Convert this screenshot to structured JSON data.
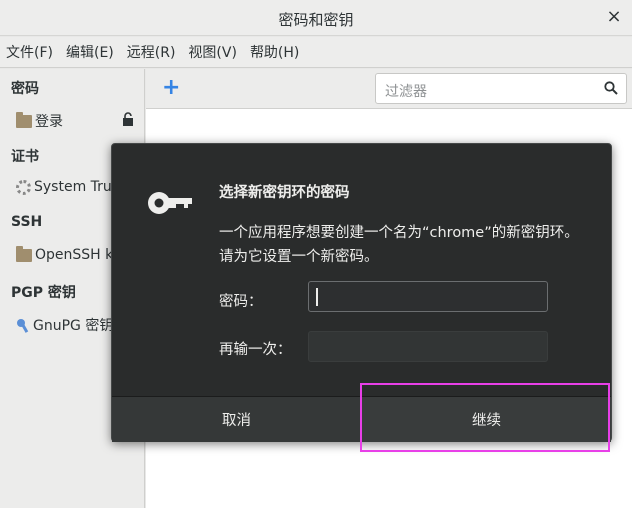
{
  "window": {
    "title": "密码和密钥",
    "close_glyph": "×"
  },
  "menu": [
    "文件(F)",
    "编辑(E)",
    "远程(R)",
    "视图(V)",
    "帮助(H)"
  ],
  "sidebar": {
    "passwords_header": "密码",
    "login_item": "登录",
    "certs_header": "证书",
    "system_trust_item": "System Trust",
    "ssh_header": "SSH",
    "openssh_item": "OpenSSH keys",
    "pgp_header": "PGP 密钥",
    "gnupg_item": "GnuPG 密钥"
  },
  "toolbar": {
    "add_glyph": "+",
    "filter_placeholder": "过滤器"
  },
  "dialog": {
    "title": "选择新密钥环的密码",
    "message": "一个应用程序想要创建一个名为“chrome”的新密钥环。请为它设置一个新密码。",
    "password_label": "密码：",
    "confirm_label": "再输一次：",
    "cancel_label": "取消",
    "continue_label": "继续"
  },
  "colors": {
    "accent": "#3584e4",
    "highlight": "#e83fe8",
    "dialog_bg": "#2a2c2c"
  }
}
